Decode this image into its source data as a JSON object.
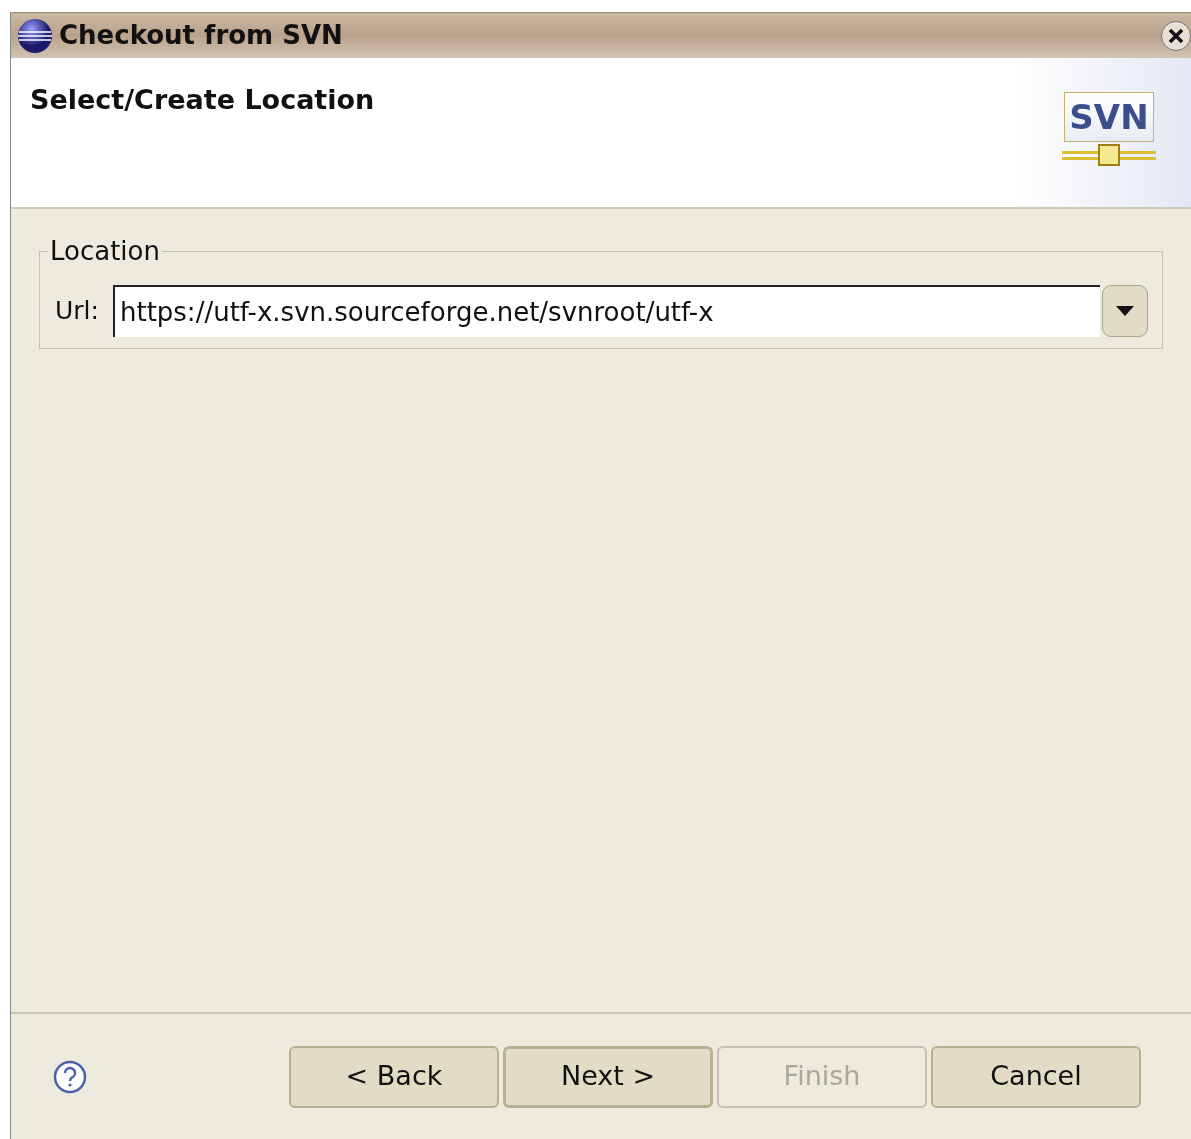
{
  "window": {
    "title": "Checkout from SVN"
  },
  "header": {
    "title": "Select/Create Location",
    "logo_text": "SVN"
  },
  "location_group": {
    "legend": "Location",
    "url_label": "Url:",
    "url_value": "https://utf-x.svn.sourceforge.net/svnroot/utf-x"
  },
  "buttons": [
    {
      "label": "< Back",
      "default": false,
      "disabled": false
    },
    {
      "label": "Next >",
      "default": true,
      "disabled": false
    },
    {
      "label": "Finish",
      "default": false,
      "disabled": true
    },
    {
      "label": "Cancel",
      "default": false,
      "disabled": false
    }
  ]
}
